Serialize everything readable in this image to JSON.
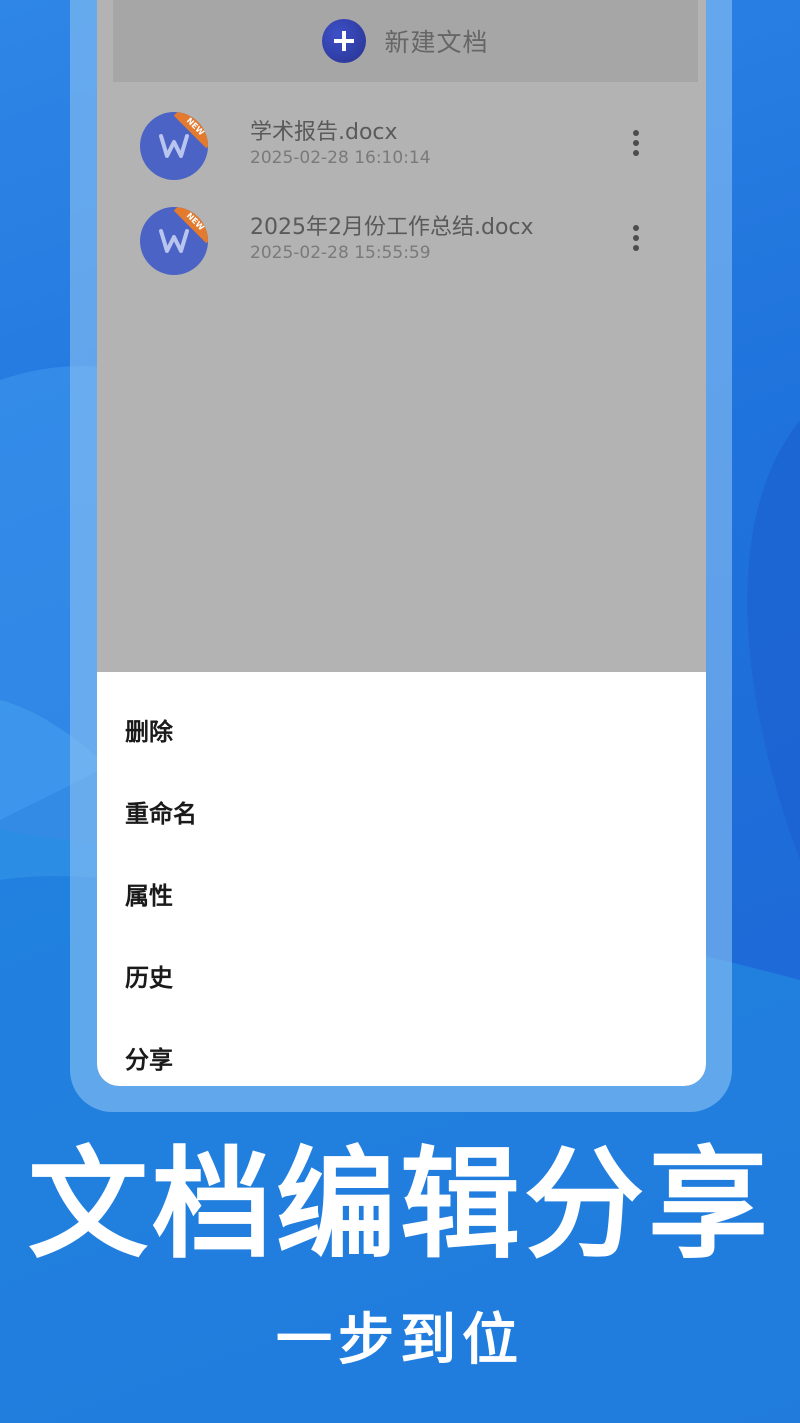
{
  "colors": {
    "background": "#2074dc",
    "screen_dim": "#b3b3b3",
    "accent_orange": "#e37a2e",
    "avatar_blue": "#4b63c4"
  },
  "toolbar": {
    "new_doc_label": "新建文档",
    "icon": "plus-icon"
  },
  "files": [
    {
      "name": "学术报告.docx",
      "time": "2025-02-28 16:10:14",
      "badge": "NEW"
    },
    {
      "name": "2025年2月份工作总结.docx",
      "time": "2025-02-28 15:55:59",
      "badge": "NEW"
    }
  ],
  "menu": {
    "delete": "删除",
    "rename": "重命名",
    "properties": "属性",
    "history": "历史",
    "share": "分享"
  },
  "promo": {
    "headline": "文档编辑分享",
    "subline": "一步到位"
  }
}
